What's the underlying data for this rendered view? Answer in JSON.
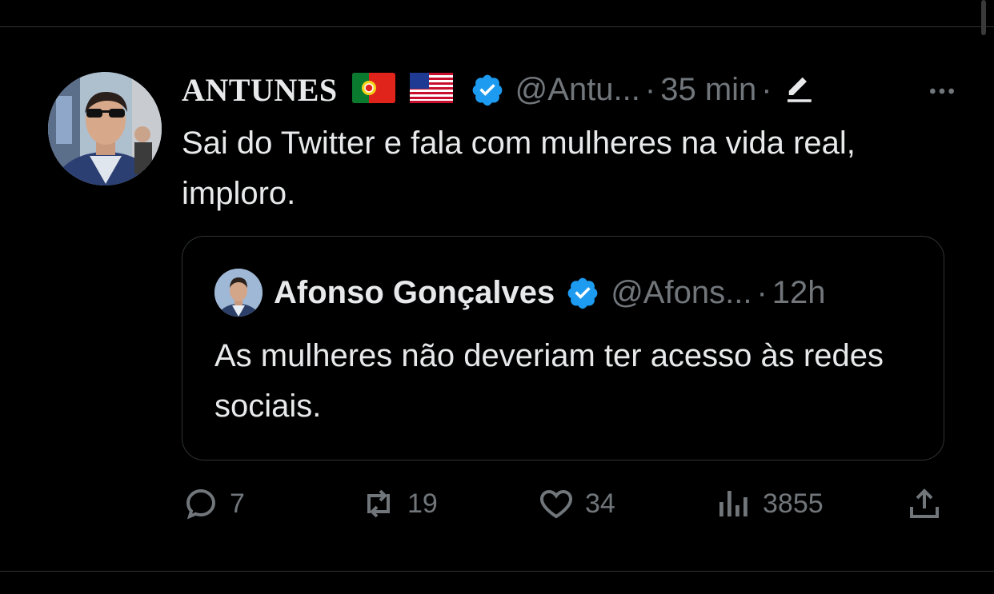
{
  "tweet": {
    "author": {
      "display_name": "ANTUNES",
      "flags": [
        "portugal-flag",
        "usa-flag"
      ],
      "verified": true,
      "handle": "@Antu...",
      "time": "35 min"
    },
    "text": "Sai do Twitter e fala com mulheres na vida real, imploro.",
    "quote": {
      "display_name": "Afonso Gonçalves",
      "verified": true,
      "handle": "@Afons...",
      "time": "12h",
      "text": "As mulheres não deveriam ter acesso às redes sociais."
    },
    "actions": {
      "replies": "7",
      "retweets": "19",
      "likes": "34",
      "views": "3855"
    }
  },
  "colors": {
    "background": "#000000",
    "text_primary": "#e7e9ea",
    "text_secondary": "#71767b",
    "border": "#2f3336",
    "verified_blue": "#1d9bf0"
  },
  "icons": [
    "more-icon",
    "edit-icon",
    "reply-icon",
    "retweet-icon",
    "like-icon",
    "views-icon",
    "share-icon",
    "verified-badge-icon"
  ]
}
